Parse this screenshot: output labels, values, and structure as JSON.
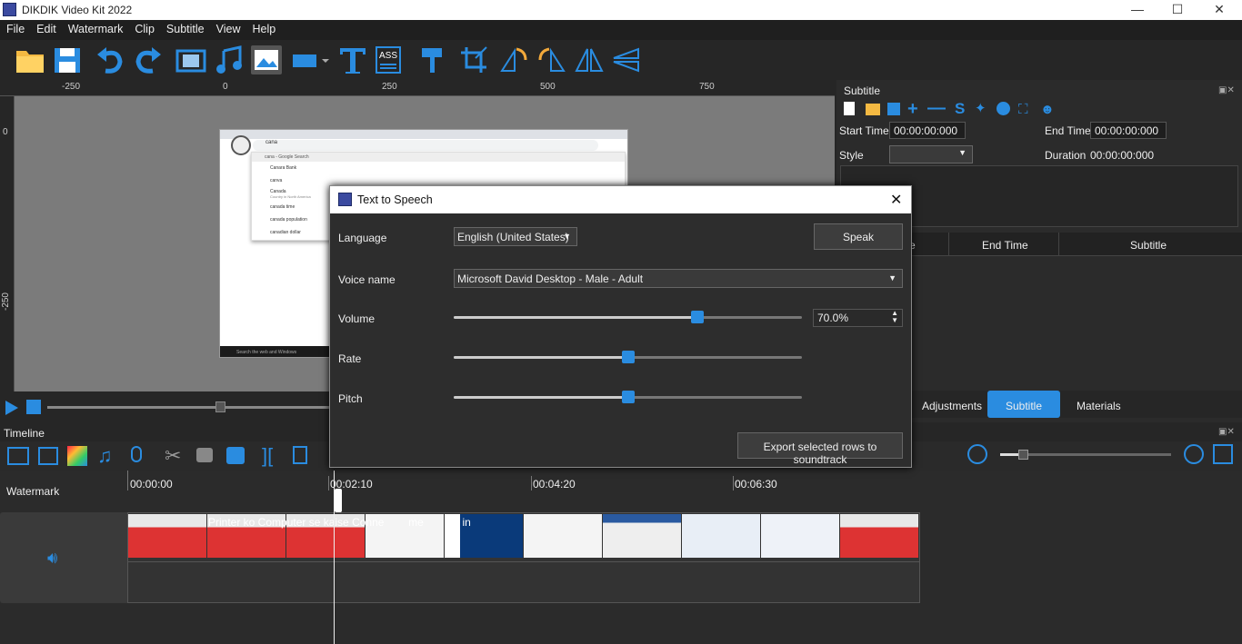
{
  "app": {
    "title": "DIKDIK Video Kit 2022"
  },
  "window_controls": {
    "minimize": "—",
    "maximize": "☐",
    "close": "✕"
  },
  "menu": [
    "File",
    "Edit",
    "Watermark",
    "Clip",
    "Subtitle",
    "View",
    "Help"
  ],
  "toolbar": {
    "ass_label": "ASS"
  },
  "ruler": {
    "top_ticks": [
      "-250",
      "0",
      "250",
      "500",
      "750"
    ],
    "left_ticks": [
      "0",
      "-250"
    ]
  },
  "subtitle_panel": {
    "title": "Subtitle",
    "start_time_label": "Start Time",
    "start_time": "00:00:00:000",
    "end_time_label": "End Time",
    "end_time": "00:00:00:000",
    "style_label": "Style",
    "duration_label": "Duration",
    "duration": "00:00:00:000",
    "table_headers": [
      "e",
      "End Time",
      "Subtitle"
    ],
    "tabs": [
      "Adjustments",
      "Subtitle",
      "Materials"
    ],
    "active_tab": "Subtitle",
    "accent": "#2a8ce0"
  },
  "preview": {
    "search_text": "cana",
    "items": [
      "cana - Google Search",
      "Canara Bank",
      "canva",
      "Canada",
      "Country in North America",
      "canada time",
      "canada population",
      "canadian dollar"
    ],
    "taskbar_text": "Search the web and Windows"
  },
  "timeline": {
    "title": "Timeline",
    "track_label": "Watermark",
    "times": [
      "00:00:00",
      "00:02:10",
      "00:04:20",
      "00:06:30"
    ],
    "caption_text": "Printer ko Computer se kaise Conne        me        se in"
  },
  "dialog": {
    "title": "Text to Speech",
    "close": "✕",
    "language_label": "Language",
    "language": "English (United States)",
    "speak": "Speak",
    "voice_label": "Voice name",
    "voice": "Microsoft David Desktop - Male - Adult",
    "volume_label": "Volume",
    "volume_value": "70.0%",
    "volume_level": 0.7,
    "rate_label": "Rate",
    "rate_level": 0.5,
    "pitch_label": "Pitch",
    "pitch_level": 0.5,
    "export": "Export selected rows to soundtrack"
  }
}
